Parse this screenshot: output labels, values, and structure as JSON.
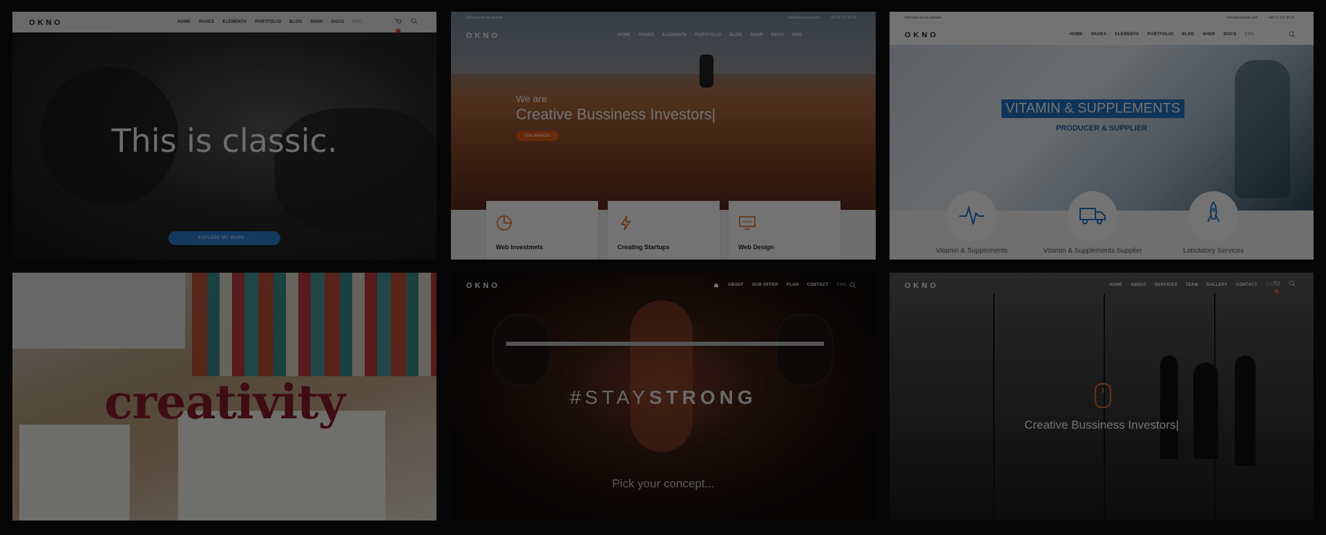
{
  "tile1": {
    "logo": "OKNO",
    "nav": [
      "HOME",
      "PAGES",
      "ELEMENTS",
      "PORTFOLIO",
      "BLOG",
      "SHOP",
      "DOCS",
      "ENG"
    ],
    "cart_count": "0",
    "headline": "This is classic.",
    "cta": "EXPLORE MY WORK"
  },
  "tile2": {
    "topbar_left": "Welcome to our website",
    "topbar_email": "hello@example.com",
    "topbar_phone": "+44 21 012 30 21",
    "logo": "OKNO",
    "nav": [
      "HOME",
      "PAGES",
      "ELEMENTS",
      "PORTFOLIO",
      "BLOG",
      "SHOP",
      "DOCS",
      "ENG"
    ],
    "small_title": "We are",
    "big_title": "Creative Bussiness Investors|",
    "button": "OUR SERVICES",
    "cards": [
      {
        "title": "Web Investmets",
        "icon": "pie-chart-icon"
      },
      {
        "title": "Creating Startups",
        "icon": "lightning-icon"
      },
      {
        "title": "Web Design",
        "icon": "monitor-icon"
      }
    ],
    "accent": "#e55f1a"
  },
  "tile3": {
    "topbar_left": "Welcome to our website",
    "topbar_email": "hello@example.com",
    "topbar_phone": "+44 21 012 30 21",
    "logo": "OKNO",
    "nav": [
      "HOME",
      "PAGES",
      "ELEMENTS",
      "PORTFOLIO",
      "BLOG",
      "SHOP",
      "DOCS",
      "ENG"
    ],
    "title": "VITAMIN & SUPPLEMENTS",
    "subtitle": "PRODUCER & SUPPLIER",
    "services": [
      {
        "title": "Vitamin & Supplements",
        "icon": "heartbeat-icon"
      },
      {
        "title": "Vitamin & Supplements Supplier",
        "icon": "truck-icon"
      },
      {
        "title": "Labolatory Services",
        "icon": "rocket-icon"
      }
    ],
    "accent": "#1f73c6"
  },
  "tile4": {
    "word": "creativity"
  },
  "tile5": {
    "logo": "OKNO",
    "nav": [
      "ABOUT",
      "OUR OFFER",
      "PLAN",
      "CONTACT",
      "ENG"
    ],
    "tag_light": "#STAY",
    "tag_bold": "STRONG",
    "pick": "Pick your concept..."
  },
  "tile6": {
    "logo": "OKNO",
    "nav": [
      "HOME",
      "ABOUT",
      "SERVICES",
      "TEAM",
      "GALLERY",
      "CONTACT",
      "ENG"
    ],
    "cart_count": "0",
    "headline": "Creative Bussiness Investors|",
    "accent": "#e86a2a"
  }
}
